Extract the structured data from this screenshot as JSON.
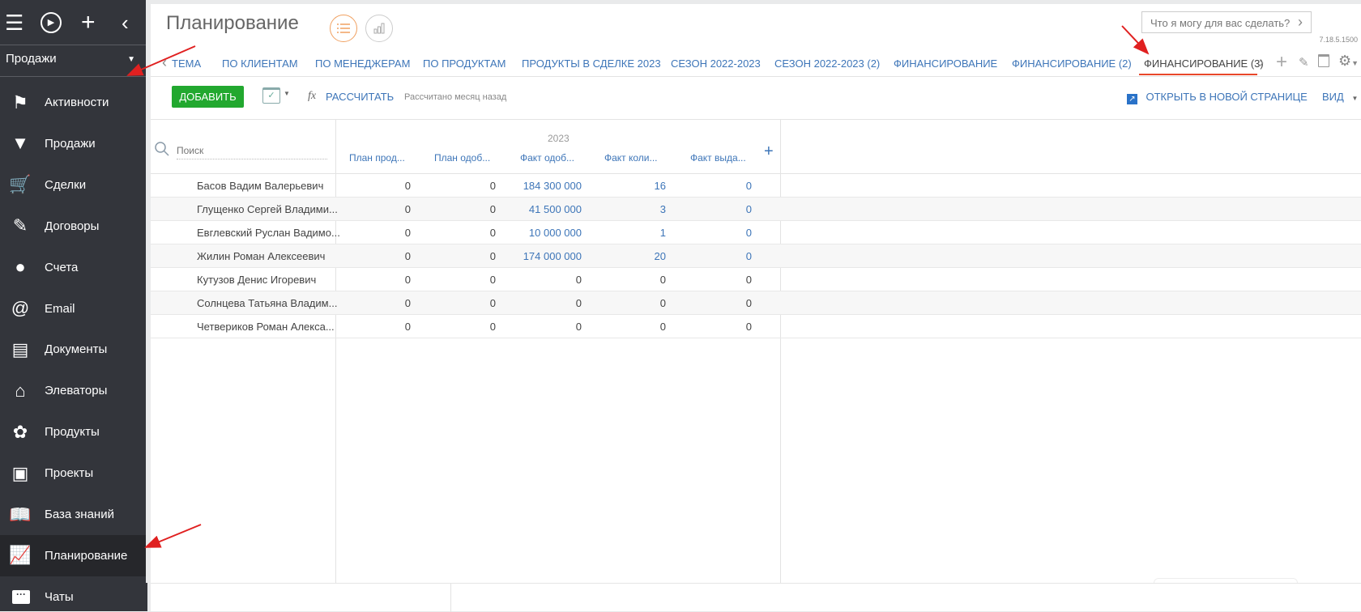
{
  "sidebar": {
    "top_icons": [
      "menu-icon",
      "play-icon",
      "plus-icon",
      "chevron-left-icon"
    ],
    "workplace": "Продажи",
    "items": [
      {
        "label": "Активности",
        "icon": "flag-icon"
      },
      {
        "label": "Продажи",
        "icon": "funnel-icon"
      },
      {
        "label": "Сделки",
        "icon": "cart-icon"
      },
      {
        "label": "Договоры",
        "icon": "contract-icon"
      },
      {
        "label": "Счета",
        "icon": "coins-icon"
      },
      {
        "label": "Email",
        "icon": "at-icon"
      },
      {
        "label": "Документы",
        "icon": "document-icon"
      },
      {
        "label": "Элеваторы",
        "icon": "warehouse-icon"
      },
      {
        "label": "Продукты",
        "icon": "leaf-icon"
      },
      {
        "label": "Проекты",
        "icon": "projects-icon"
      },
      {
        "label": "База знаний",
        "icon": "book-icon"
      },
      {
        "label": "Планирование",
        "icon": "chart-icon",
        "active": true
      }
    ],
    "chats": "Чаты"
  },
  "header": {
    "title": "Планирование",
    "search_placeholder": "Что я могу для вас сделать?",
    "version": "7.18.5.1500"
  },
  "tabs": [
    {
      "label": "ТЕМА"
    },
    {
      "label": "ПО КЛИЕНТАМ"
    },
    {
      "label": "ПО МЕНЕДЖЕРАМ"
    },
    {
      "label": "ПО ПРОДУКТАМ"
    },
    {
      "label": "ПРОДУКТЫ В СДЕЛКЕ 2023"
    },
    {
      "label": "СЕЗОН 2022-2023"
    },
    {
      "label": "СЕЗОН 2022-2023 (2)"
    },
    {
      "label": "ФИНАНСИРОВАНИЕ"
    },
    {
      "label": "ФИНАНСИРОВАНИЕ (2)"
    },
    {
      "label": "ФИНАНСИРОВАНИЕ (3)",
      "active": true
    }
  ],
  "toolbar": {
    "add": "ДОБАВИТЬ",
    "calculate": "РАССЧИТАТЬ",
    "calc_status": "Рассчитано месяц назад",
    "open_new": "ОТКРЫТЬ В НОВОЙ СТРАНИЦЕ",
    "view": "ВИД"
  },
  "table": {
    "search_placeholder": "Поиск",
    "period": "2023",
    "columns": [
      "План прод...",
      "План одоб...",
      "Факт одоб...",
      "Факт коли...",
      "Факт выда..."
    ],
    "rows": [
      {
        "name": "Басов Вадим Валерьевич",
        "values": [
          "0",
          "0",
          "184 300 000",
          "16",
          "0"
        ]
      },
      {
        "name": "Глущенко Сергей Владими...",
        "values": [
          "0",
          "0",
          "41 500 000",
          "3",
          "0"
        ]
      },
      {
        "name": "Евглевский Руслан Вадимо...",
        "values": [
          "0",
          "0",
          "10 000 000",
          "1",
          "0"
        ]
      },
      {
        "name": "Жилин Роман Алексеевич",
        "values": [
          "0",
          "0",
          "174 000 000",
          "20",
          "0"
        ]
      },
      {
        "name": "Кутузов Денис Игоревич",
        "values": [
          "0",
          "0",
          "0",
          "0",
          "0"
        ]
      },
      {
        "name": "Солнцева Татьяна Владим...",
        "values": [
          "0",
          "0",
          "0",
          "0",
          "0"
        ]
      },
      {
        "name": "Четвериков Роман Алекса...",
        "values": [
          "0",
          "0",
          "0",
          "0",
          "0"
        ]
      }
    ]
  },
  "colors": {
    "accent": "#3d75b8",
    "add_button": "#22a82f",
    "active_tab_underline": "#e8472a",
    "sidebar": "#33353b",
    "annotation_arrow": "#e02020"
  }
}
